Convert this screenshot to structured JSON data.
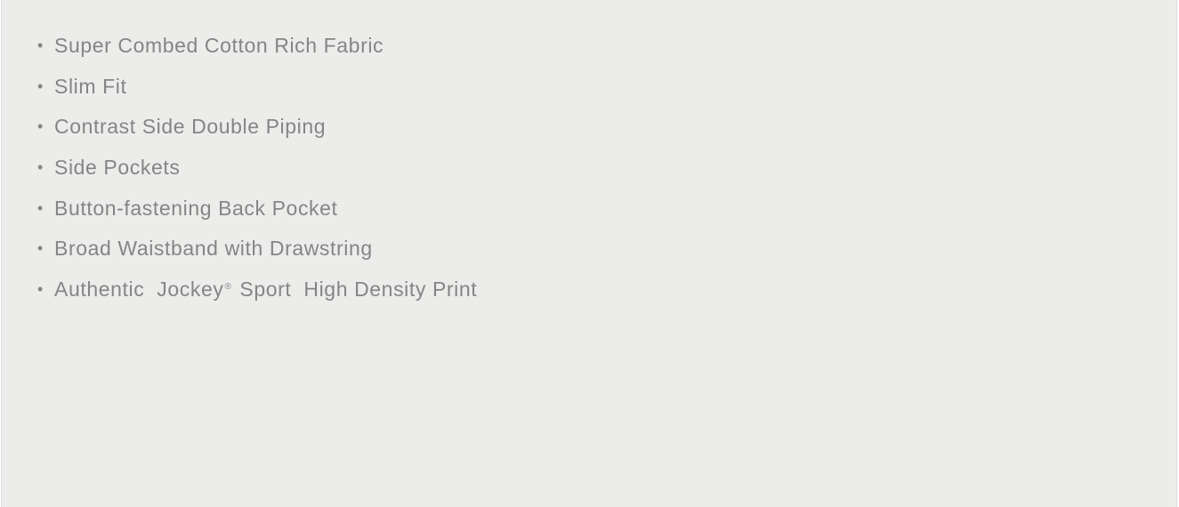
{
  "features": {
    "bullet": "•",
    "items": [
      "Super Combed Cotton Rich Fabric",
      "Slim Fit",
      "Contrast Side Double Piping",
      "Side Pockets",
      "Button-fastening Back Pocket",
      "Broad Waistband with Drawstring"
    ],
    "last_item": {
      "before": "Authentic  Jockey",
      "mark": "®",
      "after": " Sport  High Density Print"
    }
  }
}
